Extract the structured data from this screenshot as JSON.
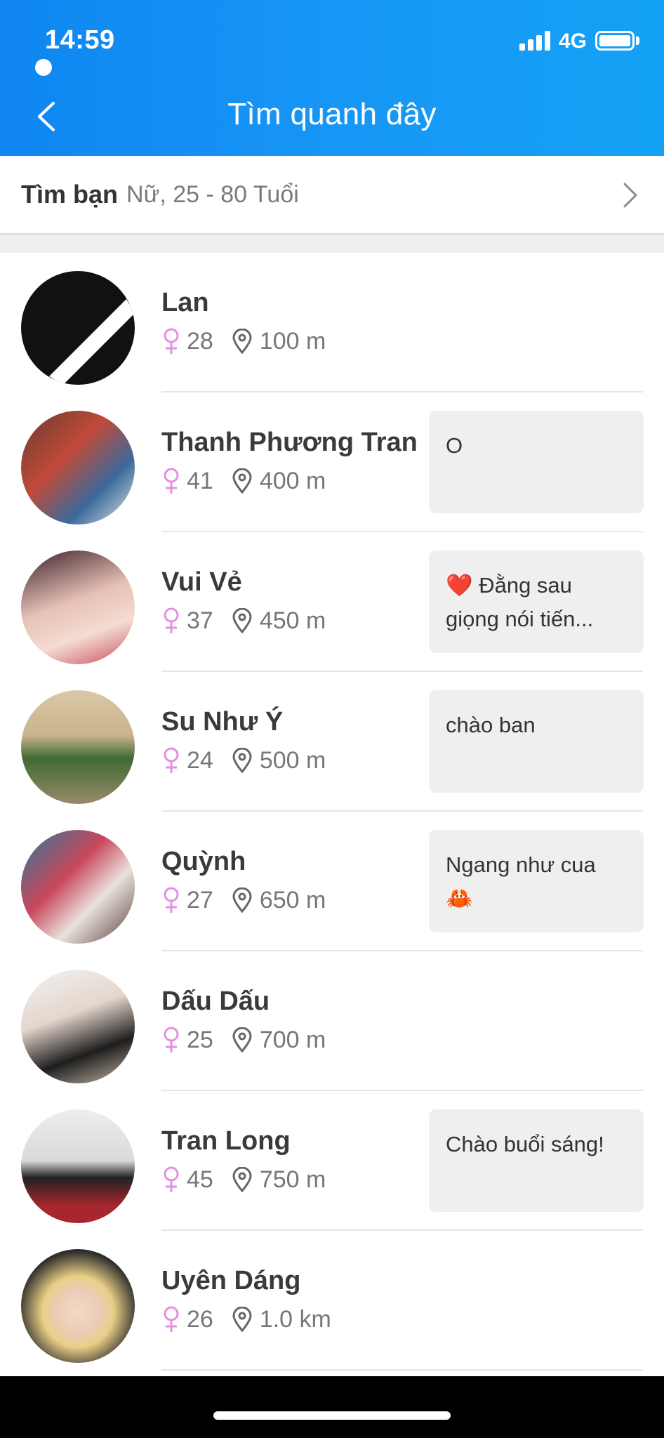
{
  "status_bar": {
    "time": "14:59",
    "network": "4G"
  },
  "header": {
    "title": "Tìm quanh đây",
    "back_icon": "chevron-left-icon"
  },
  "filter": {
    "label": "Tìm bạn",
    "value": "Nữ, 25 - 80 Tuổi"
  },
  "colors": {
    "header_blue": "#1796f5",
    "gender_female": "#e48fe6",
    "bubble_bg": "#efefef"
  },
  "users": [
    {
      "name": "Lan",
      "age": "28",
      "distance": "100 m",
      "message": ""
    },
    {
      "name": "Thanh Phương Tran",
      "age": "41",
      "distance": "400 m",
      "message": "O"
    },
    {
      "name": "Vui Vẻ",
      "age": "37",
      "distance": "450 m",
      "message": "❤️ Đằng sau giọng nói tiến..."
    },
    {
      "name": "Su Như Ý",
      "age": "24",
      "distance": "500 m",
      "message": "chào ban"
    },
    {
      "name": "Quỳnh",
      "age": "27",
      "distance": "650 m",
      "message": "Ngang như cua 🦀"
    },
    {
      "name": "Dấu Dấu",
      "age": "25",
      "distance": "700 m",
      "message": ""
    },
    {
      "name": "Tran Long",
      "age": "45",
      "distance": "750 m",
      "message": "Chào buổi sáng!"
    },
    {
      "name": "Uyên Dáng",
      "age": "26",
      "distance": "1.0 km",
      "message": ""
    }
  ]
}
